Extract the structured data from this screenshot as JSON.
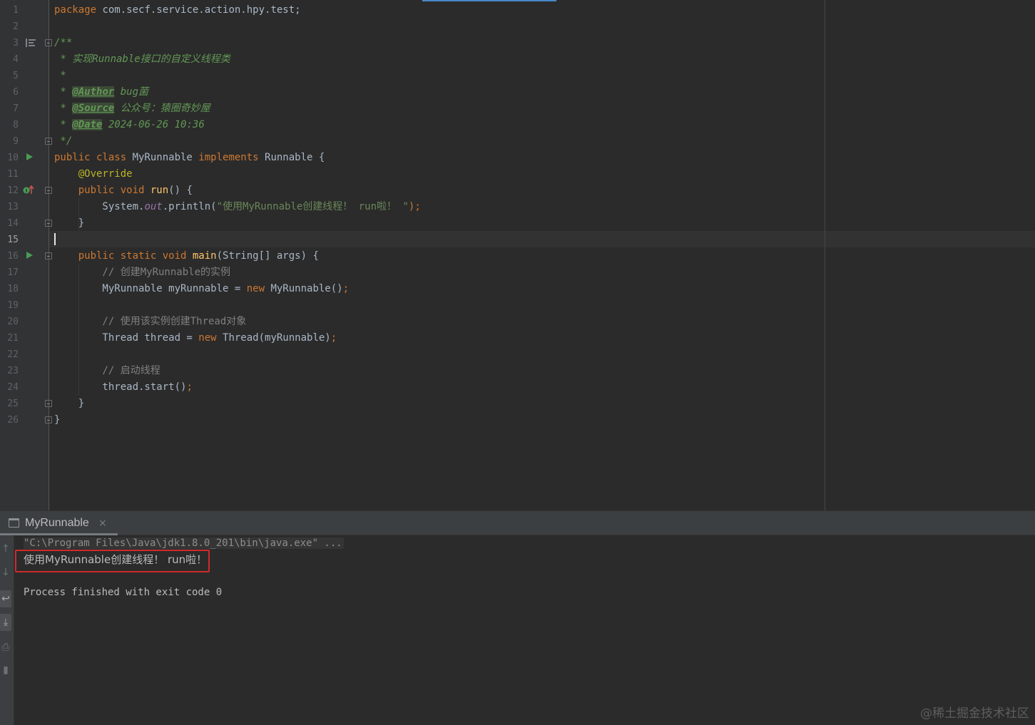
{
  "editor": {
    "line_numbers": [
      "1",
      "2",
      "3",
      "4",
      "5",
      "6",
      "7",
      "8",
      "9",
      "10",
      "11",
      "12",
      "13",
      "14",
      "15",
      "16",
      "17",
      "18",
      "19",
      "20",
      "21",
      "22",
      "23",
      "24",
      "25",
      "26"
    ],
    "current_line": "15",
    "lines": {
      "l1": [
        "package",
        " com.secf.service.action.hpy.test;"
      ],
      "l3": "/**",
      "l4": " * 实现Runnable接口的自定义线程类",
      "l5": " *",
      "l6": [
        " * ",
        "@Author",
        " bug菌"
      ],
      "l7": [
        " * ",
        "@Source",
        " 公众号：猿圈奇妙屋"
      ],
      "l8": [
        " * ",
        "@Date",
        " 2024-06-26 10:36"
      ],
      "l9": " */",
      "l10": [
        "public class ",
        "MyRunnable ",
        "implements ",
        "Runnable {"
      ],
      "l11": "    @Override",
      "l12": [
        "    public void ",
        "run",
        "() {"
      ],
      "l13": [
        "        System.",
        "out",
        ".println(",
        "\"使用MyRunnable创建线程！ run啦！ \"",
        ");"
      ],
      "l14": "    }",
      "l16": [
        "    public static void ",
        "main",
        "(String[] args) {"
      ],
      "l17": "        // 创建MyRunnable的实例",
      "l18": [
        "        MyRunnable myRunnable = ",
        "new ",
        "MyRunnable()",
        ";"
      ],
      "l20": "        // 使用该实例创建Thread对象",
      "l21": [
        "        Thread thread = ",
        "new ",
        "Thread(myRunnable)",
        ";"
      ],
      "l23": "        // 启动线程",
      "l24": [
        "        thread.start()",
        ";"
      ],
      "l25": "    }",
      "l26": "}"
    },
    "gutter_icons": {
      "run_lines": [
        "10",
        "16"
      ],
      "implements_line": "12"
    }
  },
  "run_panel": {
    "tab_label": "MyRunnable",
    "tab_close": "×",
    "command_line": "\"C:\\Program Files\\Java\\jdk1.8.0_201\\bin\\java.exe\" ...",
    "output_line": "使用MyRunnable创建线程！ run啦！",
    "exit_message": "Process finished with exit code 0",
    "toolbar_icons": [
      "up-arrow-icon",
      "down-arrow-icon",
      "soft-wrap-icon",
      "scroll-to-end-icon",
      "print-icon",
      "trash-icon"
    ],
    "highlight_color": "#d12a2a"
  },
  "watermark": "@稀土掘金技术社区",
  "colors": {
    "background": "#2b2b2b",
    "gutter": "#313335",
    "keyword": "#cc7832",
    "comment": "#629755",
    "annotation": "#bbb529",
    "function": "#ffc66d",
    "string": "#6a8759",
    "static_field": "#9876aa",
    "line_comment": "#808080",
    "run_icon": "#499c54"
  }
}
